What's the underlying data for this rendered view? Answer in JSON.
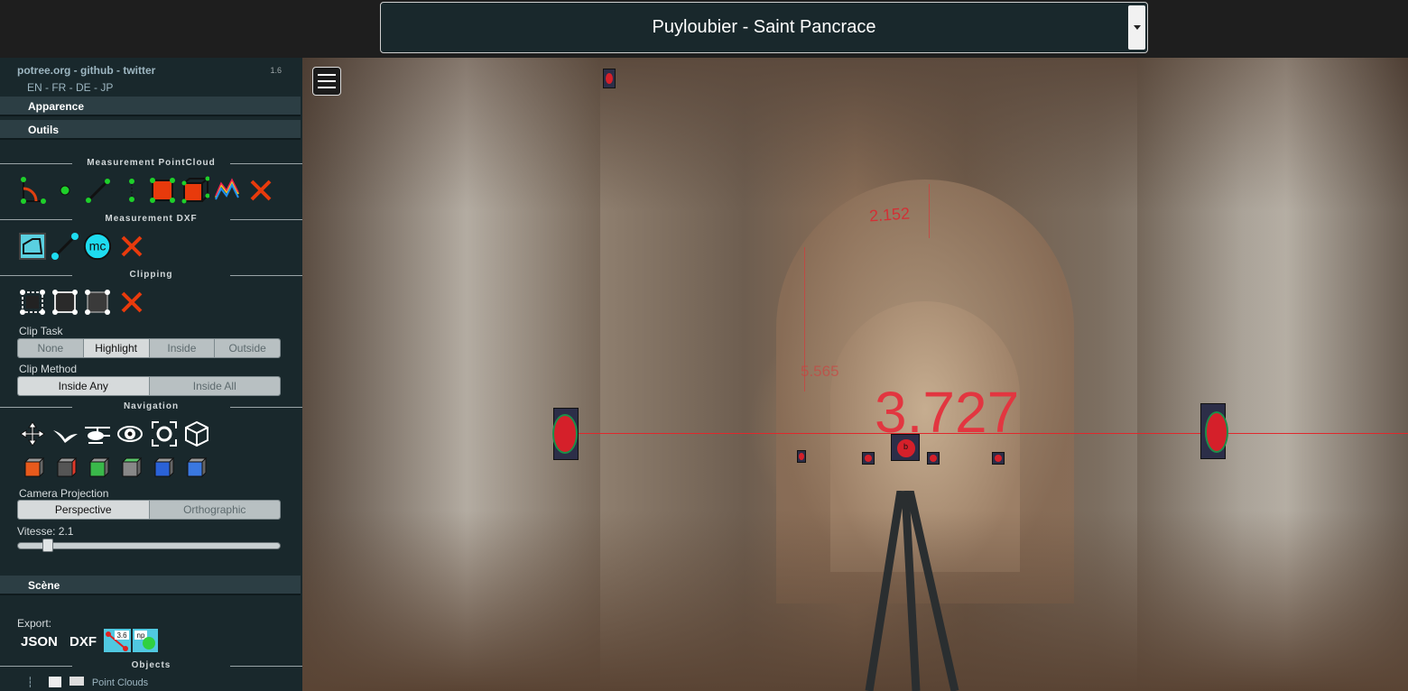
{
  "header": {
    "scene_title": "Puyloubier - Saint Pancrace"
  },
  "sidebar": {
    "links": "potree.org - github - twitter",
    "version": "1.6",
    "languages": "EN - FR - DE - JP",
    "accordion": {
      "appearance": "Apparence",
      "tools": "Outils",
      "scene": "Scène"
    },
    "sections": {
      "measurement_pointcloud": "Measurement PointCloud",
      "measurement_dxf": "Measurement DXF",
      "clipping": "Clipping",
      "navigation": "Navigation",
      "objects": "Objects"
    },
    "dxf_circle_label": "mc",
    "clip_task": {
      "label": "Clip Task",
      "options": [
        "None",
        "Highlight",
        "Inside",
        "Outside"
      ],
      "selected": "Highlight"
    },
    "clip_method": {
      "label": "Clip Method",
      "options": [
        "Inside Any",
        "Inside All"
      ],
      "selected": "Inside Any"
    },
    "camera_projection": {
      "label": "Camera Projection",
      "options": [
        "Perspective",
        "Orthographic"
      ],
      "selected": "Perspective"
    },
    "speed": {
      "label": "Vitesse: 2.1",
      "value": 2.1,
      "fraction": 0.1
    },
    "export": {
      "label": "Export:",
      "json": "JSON",
      "dxf": "DXF",
      "badge_1": "3.6",
      "badge_2": "np"
    },
    "objects_item": "Point Clouds"
  },
  "viewport": {
    "distance_main": "3.727",
    "distance_ceiling": "2.152",
    "distance_side": "5.565",
    "target_label": "b"
  },
  "colors": {
    "accent_red": "#e0282c",
    "panel_bg": "#19282c",
    "measure_green": "#1c8f4a"
  },
  "icons": {
    "measurement_pointcloud": [
      "angle-icon",
      "point-icon",
      "distance-icon",
      "height-icon",
      "area-icon",
      "volume-icon",
      "profile-icon",
      "remove-measurements-icon"
    ],
    "measurement_dxf": [
      "dxf-area-icon",
      "dxf-line-icon",
      "dxf-circle-icon",
      "remove-dxf-icon"
    ],
    "clipping": [
      "clip-volume-icon",
      "clip-polygon-icon",
      "clip-plane-icon",
      "remove-clip-icon"
    ],
    "navigation": [
      "earth-controls-icon",
      "fly-controls-icon",
      "helicopter-controls-icon",
      "orbit-controls-icon",
      "focus-icon",
      "navigation-cube-icon"
    ],
    "views": [
      "left-view-icon",
      "front-view-icon",
      "top-view-icon",
      "right-view-icon",
      "bottom-view-icon",
      "back-view-icon"
    ]
  }
}
